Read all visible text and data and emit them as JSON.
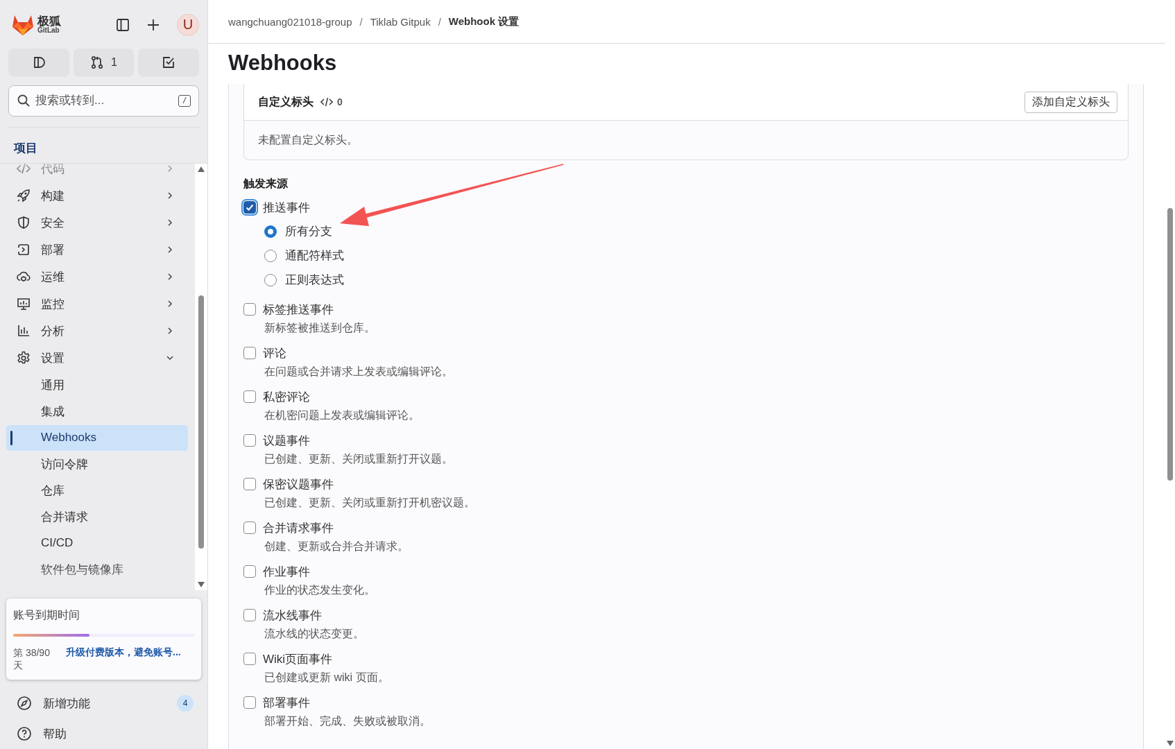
{
  "sidebar": {
    "logo": {
      "name": "极狐",
      "sub": "GitLab"
    },
    "avatar": "U",
    "quick_actions": [
      {
        "kind": "issues"
      },
      {
        "kind": "merge_requests",
        "count": "1"
      },
      {
        "kind": "todos"
      }
    ],
    "search": {
      "placeholder": "搜索或转到...",
      "shortcut": "/"
    },
    "section_title": "项目",
    "items": [
      {
        "label": "代码",
        "expanded": false
      },
      {
        "label": "构建",
        "expanded": false
      },
      {
        "label": "安全",
        "expanded": false
      },
      {
        "label": "部署",
        "expanded": false
      },
      {
        "label": "运维",
        "expanded": false
      },
      {
        "label": "监控",
        "expanded": false
      },
      {
        "label": "分析",
        "expanded": false
      },
      {
        "label": "设置",
        "expanded": true,
        "children": [
          {
            "label": "通用",
            "selected": false
          },
          {
            "label": "集成",
            "selected": false
          },
          {
            "label": "Webhooks",
            "selected": true
          },
          {
            "label": "访问令牌",
            "selected": false
          },
          {
            "label": "仓库",
            "selected": false
          },
          {
            "label": "合并请求",
            "selected": false
          },
          {
            "label": "CI/CD",
            "selected": false
          },
          {
            "label": "软件包与镜像库",
            "selected": false
          }
        ]
      }
    ],
    "trial": {
      "title": "账号到期时间",
      "level": 0.42,
      "days": "第 38/90 天",
      "link": "升级付费版本，避免账号..."
    },
    "footer": [
      {
        "label": "新增功能",
        "badge": "4"
      },
      {
        "label": "帮助"
      }
    ]
  },
  "breadcrumb": [
    {
      "label": "wangchuang021018-group",
      "current": false
    },
    {
      "label": "Tiklab Gitpuk",
      "current": false
    },
    {
      "label": "Webhook 设置",
      "current": true
    }
  ],
  "breadcrumb_separator": "/",
  "title": "Webhooks",
  "custom_headers": {
    "title": "自定义标头",
    "count": "0",
    "button": "添加自定义标头",
    "empty": "未配置自定义标头。"
  },
  "trigger": {
    "title": "触发来源",
    "events": [
      {
        "label": "推送事件",
        "checked": true,
        "options": [
          {
            "label": "所有分支",
            "selected": true
          },
          {
            "label": "通配符样式",
            "selected": false
          },
          {
            "label": "正则表达式",
            "selected": false
          }
        ]
      },
      {
        "label": "标签推送事件",
        "description": "新标签被推送到仓库。",
        "checked": false
      },
      {
        "label": "评论",
        "description": "在问题或合并请求上发表或编辑评论。",
        "checked": false
      },
      {
        "label": "私密评论",
        "description": "在机密问题上发表或编辑评论。",
        "checked": false
      },
      {
        "label": "议题事件",
        "description": "已创建、更新、关闭或重新打开议题。",
        "checked": false
      },
      {
        "label": "保密议题事件",
        "description": "已创建、更新、关闭或重新打开机密议题。",
        "checked": false
      },
      {
        "label": "合并请求事件",
        "description": "创建、更新或合并合并请求。",
        "checked": false
      },
      {
        "label": "作业事件",
        "description": "作业的状态发生变化。",
        "checked": false
      },
      {
        "label": "流水线事件",
        "description": "流水线的状态变更。",
        "checked": false
      },
      {
        "label": "Wiki页面事件",
        "description": "已创建或更新 wiki 页面。",
        "checked": false
      },
      {
        "label": "部署事件",
        "description": "部署开始、完成、失败或被取消。",
        "checked": false
      }
    ]
  }
}
